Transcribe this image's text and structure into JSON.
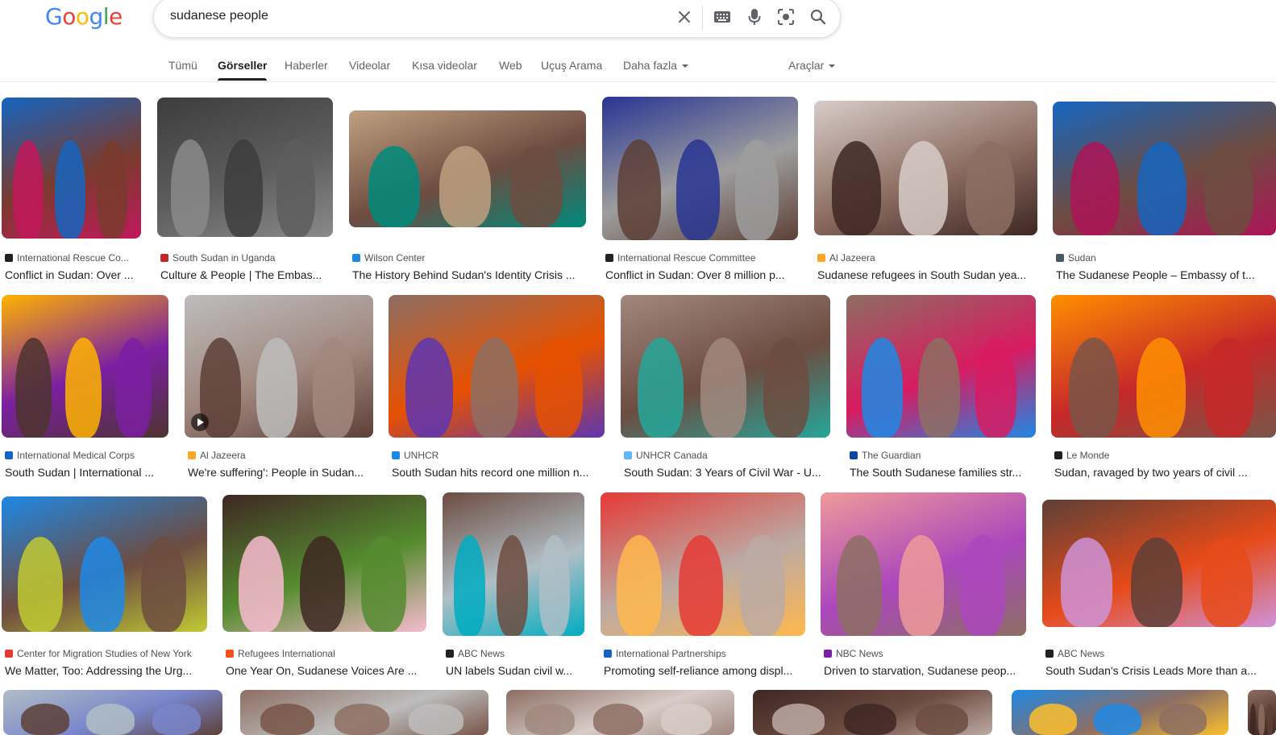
{
  "logo": {
    "text": "Google"
  },
  "search": {
    "query": "sudanese people"
  },
  "icons": [
    "close-icon",
    "keyboard-icon",
    "microphone-icon",
    "lens-icon",
    "search-icon"
  ],
  "tabs": [
    {
      "label": "Tümü"
    },
    {
      "label": "Görseller"
    },
    {
      "label": "Haberler"
    },
    {
      "label": "Videolar"
    },
    {
      "label": "Kısa videolar"
    },
    {
      "label": "Web"
    },
    {
      "label": "Uçuş Arama"
    },
    {
      "label": "Daha fazla"
    }
  ],
  "tools": {
    "label": "Araçlar"
  },
  "results": [
    {
      "source": "International Rescue Co...",
      "title": "Conflict in Sudan: Over ...",
      "fav": "#222222",
      "colors": [
        "#7a3b2e",
        "#c2185b",
        "#1565c0"
      ]
    },
    {
      "source": "South Sudan in Uganda",
      "title": "Culture & People | The Embas...",
      "fav": "#c62828",
      "colors": [
        "#5d5d5d",
        "#8a8a8a",
        "#3d3d3d"
      ]
    },
    {
      "source": "Wilson Center",
      "title": "The History Behind Sudan's Identity Crisis ...",
      "fav": "#1e88e5",
      "colors": [
        "#6d4c41",
        "#00897b",
        "#c0a080"
      ]
    },
    {
      "source": "International Rescue Committee",
      "title": "Conflict in Sudan: Over 8 million p...",
      "fav": "#222222",
      "colors": [
        "#9e9e9e",
        "#5d4037",
        "#283593"
      ]
    },
    {
      "source": "Al Jazeera",
      "title": "Sudanese refugees in South Sudan yea...",
      "fav": "#f9a825",
      "colors": [
        "#8d6e63",
        "#3e2723",
        "#d7ccc8"
      ]
    },
    {
      "source": "Sudan",
      "title": "The Sudanese People – Embassy of t...",
      "fav": "#455a64",
      "colors": [
        "#6d4c41",
        "#ad1457",
        "#1565c0"
      ]
    },
    {
      "source": "International Medical Corps",
      "title": "South Sudan | International ...",
      "fav": "#1565c0",
      "colors": [
        "#7b1fa2",
        "#4e342e",
        "#ffb300"
      ]
    },
    {
      "source": "Al Jazeera",
      "title": "We're suffering': People in Sudan...",
      "fav": "#f9a825",
      "colors": [
        "#a1887f",
        "#5d4037",
        "#bdbdbd"
      ]
    },
    {
      "source": "UNHCR",
      "title": "South Sudan hits record one million n...",
      "fav": "#1e88e5",
      "colors": [
        "#e65100",
        "#5e35b1",
        "#8d6e63"
      ]
    },
    {
      "source": "UNHCR Canada",
      "title": "South Sudan: 3 Years of Civil War - U...",
      "fav": "#64b5f6",
      "colors": [
        "#6d4c41",
        "#26a69a",
        "#a1887f"
      ]
    },
    {
      "source": "The Guardian",
      "title": "The South Sudanese families str...",
      "fav": "#0d47a1",
      "colors": [
        "#d81b60",
        "#1e88e5",
        "#8d6e63"
      ]
    },
    {
      "source": "Le Monde",
      "title": "Sudan, ravaged by two years of civil ...",
      "fav": "#212121",
      "colors": [
        "#c62828",
        "#795548",
        "#ff8f00"
      ]
    },
    {
      "source": "Center for Migration Studies of New York",
      "title": "We Matter, Too: Addressing the Urg...",
      "fav": "#e53935",
      "colors": [
        "#6d4c41",
        "#c0ca33",
        "#1e88e5"
      ]
    },
    {
      "source": "Refugees International",
      "title": "One Year On, Sudanese Voices Are ...",
      "fav": "#f4511e",
      "colors": [
        "#558b2f",
        "#f8bbd0",
        "#3e2723"
      ]
    },
    {
      "source": "ABC News",
      "title": "UN labels Sudan civil w...",
      "fav": "#212121",
      "colors": [
        "#b0bec5",
        "#00acc1",
        "#6d4c41"
      ]
    },
    {
      "source": "International Partnerships",
      "title": "Promoting self-reliance among displ...",
      "fav": "#1565c0",
      "colors": [
        "#bcaaa4",
        "#ffb74d",
        "#e53935"
      ]
    },
    {
      "source": "NBC News",
      "title": "Driven to starvation, Sudanese peop...",
      "fav": "#7b1fa2",
      "colors": [
        "#ab47bc",
        "#8d6e63",
        "#ef9a9a"
      ]
    },
    {
      "source": "ABC News",
      "title": "South Sudan's Crisis Leads More than a...",
      "fav": "#212121",
      "colors": [
        "#e64a19",
        "#ce93d8",
        "#5d4037"
      ]
    },
    {
      "colors": [
        "#7986cb",
        "#5d4037",
        "#b0bec5"
      ]
    },
    {
      "colors": [
        "#bdbdbd",
        "#795548",
        "#8d6e63"
      ]
    },
    {
      "colors": [
        "#d7ccc8",
        "#a1887f",
        "#8d6e63"
      ]
    },
    {
      "colors": [
        "#6d4c41",
        "#bcaaa4",
        "#3e2723"
      ]
    },
    {
      "colors": [
        "#8d6e63",
        "#fbc02d",
        "#1e88e5"
      ]
    },
    {
      "colors": [
        "#5d4037",
        "#3e2723",
        "#8d6e63"
      ]
    }
  ]
}
